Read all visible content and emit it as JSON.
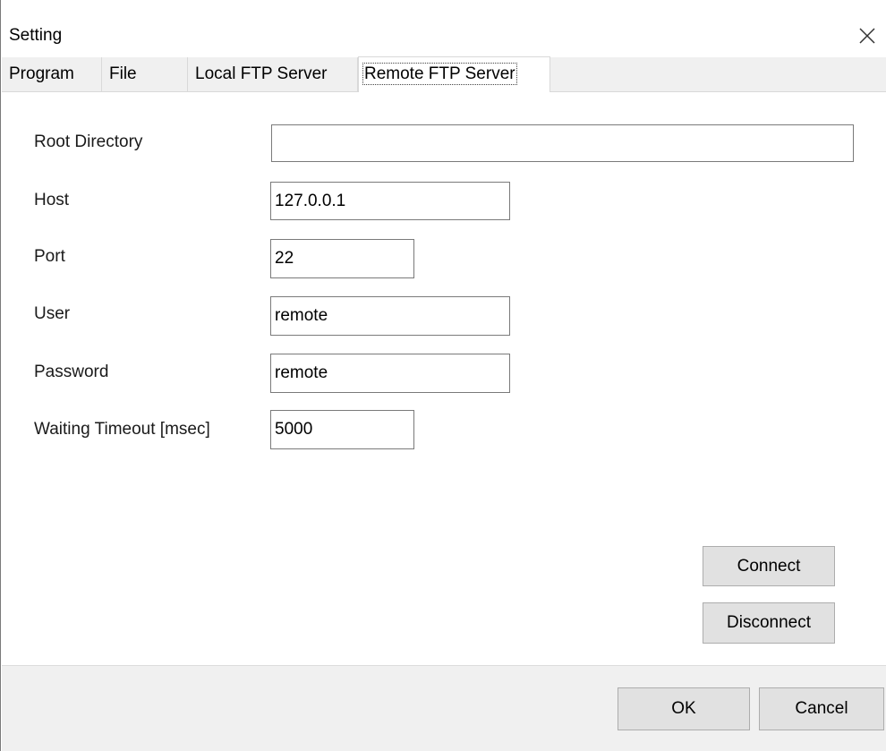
{
  "window": {
    "title": "Setting"
  },
  "tabs": [
    {
      "label": "Program",
      "active": false
    },
    {
      "label": "File",
      "active": false
    },
    {
      "label": "Local FTP Server",
      "active": false
    },
    {
      "label": "Remote FTP Server",
      "active": true
    }
  ],
  "form": {
    "root_directory": {
      "label": "Root Directory",
      "value": ""
    },
    "host": {
      "label": "Host",
      "value": "127.0.0.1"
    },
    "port": {
      "label": "Port",
      "value": "22"
    },
    "user": {
      "label": "User",
      "value": "remote"
    },
    "password": {
      "label": "Password",
      "value": "remote"
    },
    "timeout": {
      "label": "Waiting Timeout [msec]",
      "value": "5000"
    }
  },
  "buttons": {
    "connect": "Connect",
    "disconnect": "Disconnect",
    "ok": "OK",
    "cancel": "Cancel"
  },
  "icons": {
    "close": "close-icon"
  },
  "colors": {
    "tab_background": "#f0f0f0",
    "footer_background": "#f0f0f0",
    "button_background": "#e1e1e1",
    "input_border": "#7a7a7a"
  }
}
